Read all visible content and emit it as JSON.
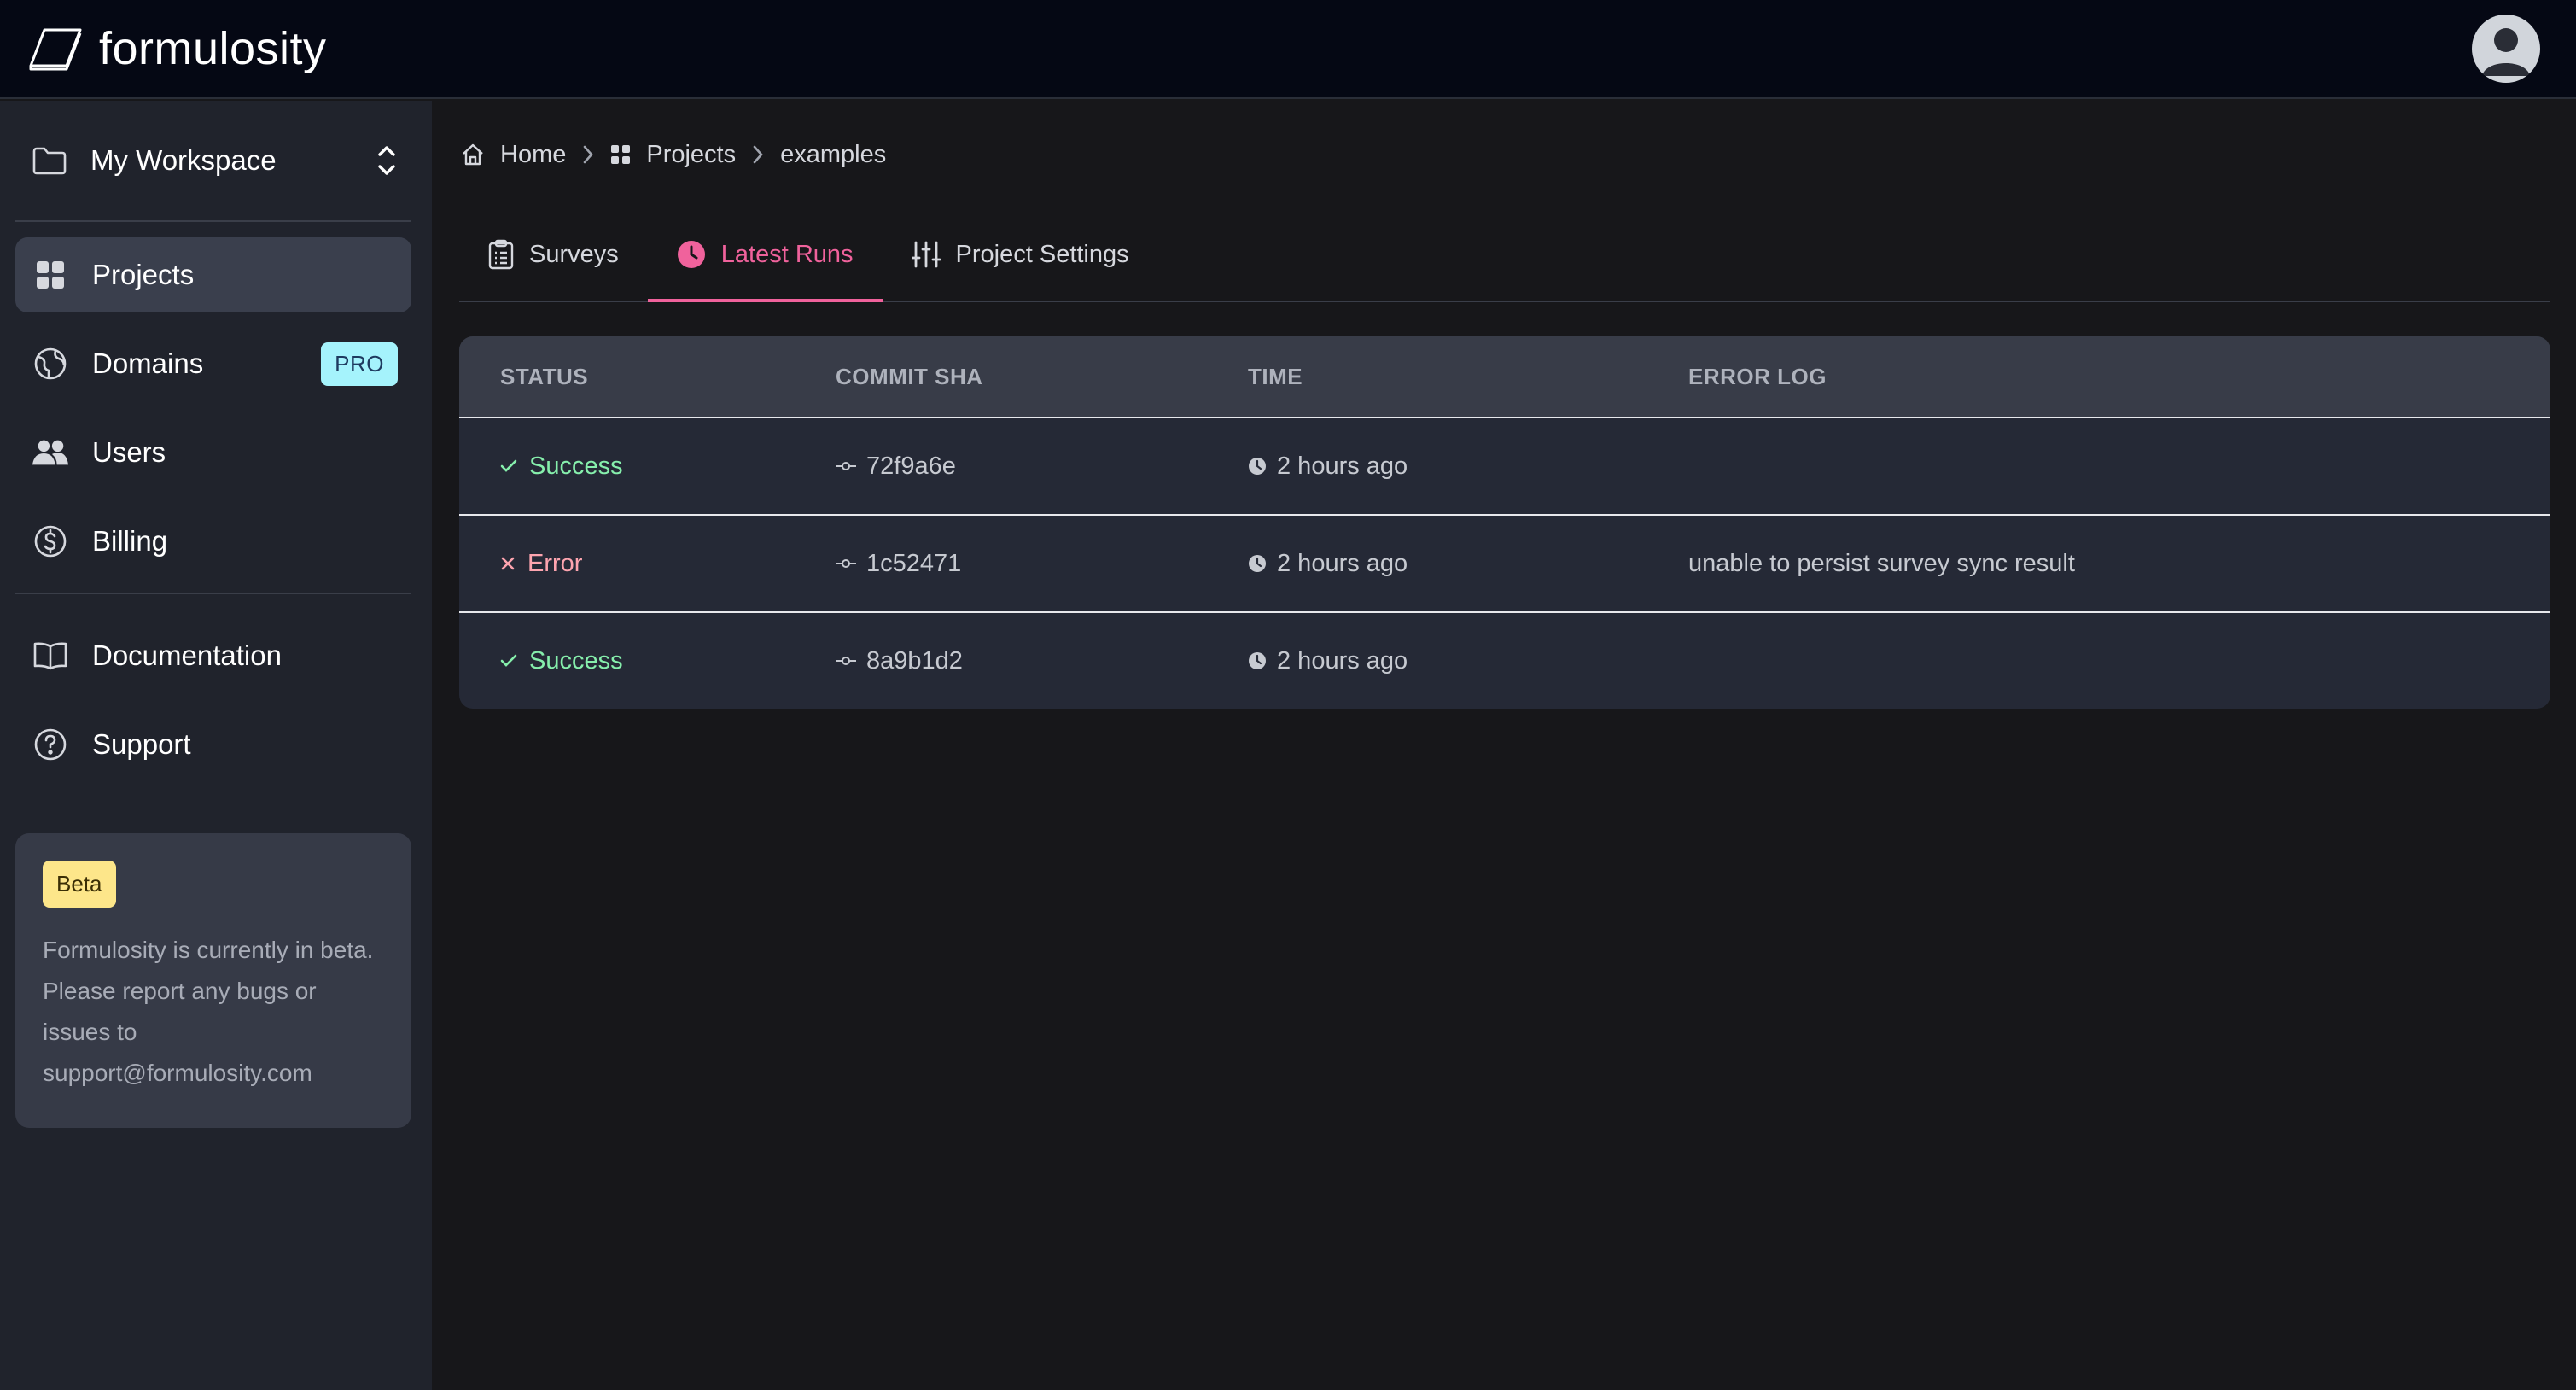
{
  "app": {
    "brand": "formulosity"
  },
  "sidebar": {
    "workspace": "My Workspace",
    "items": [
      {
        "label": "Projects",
        "icon": "grid-icon",
        "active": true
      },
      {
        "label": "Domains",
        "icon": "globe-icon",
        "badge": "PRO"
      },
      {
        "label": "Users",
        "icon": "users-icon"
      },
      {
        "label": "Billing",
        "icon": "dollar-icon"
      }
    ],
    "secondary": [
      {
        "label": "Documentation",
        "icon": "book-icon"
      },
      {
        "label": "Support",
        "icon": "help-icon"
      }
    ],
    "beta": {
      "badge": "Beta",
      "text": "Formulosity is currently in beta. Please report any bugs or issues to support@formulosity.com"
    }
  },
  "breadcrumb": {
    "home": "Home",
    "projects": "Projects",
    "current": "examples"
  },
  "tabs": [
    {
      "label": "Surveys",
      "active": false
    },
    {
      "label": "Latest Runs",
      "active": true
    },
    {
      "label": "Project Settings",
      "active": false
    }
  ],
  "table": {
    "headers": [
      "STATUS",
      "COMMIT SHA",
      "TIME",
      "ERROR LOG"
    ],
    "rows": [
      {
        "status": "Success",
        "commit": "72f9a6e",
        "time": "2 hours ago",
        "error": ""
      },
      {
        "status": "Error",
        "commit": "1c52471",
        "time": "2 hours ago",
        "error": "unable to persist survey sync result"
      },
      {
        "status": "Success",
        "commit": "8a9b1d2",
        "time": "2 hours ago",
        "error": ""
      }
    ]
  },
  "colors": {
    "accent": "#f0629c",
    "success": "#86efac",
    "error": "#fda4af",
    "topbar": "#050814",
    "sidebar": "#20232c"
  }
}
